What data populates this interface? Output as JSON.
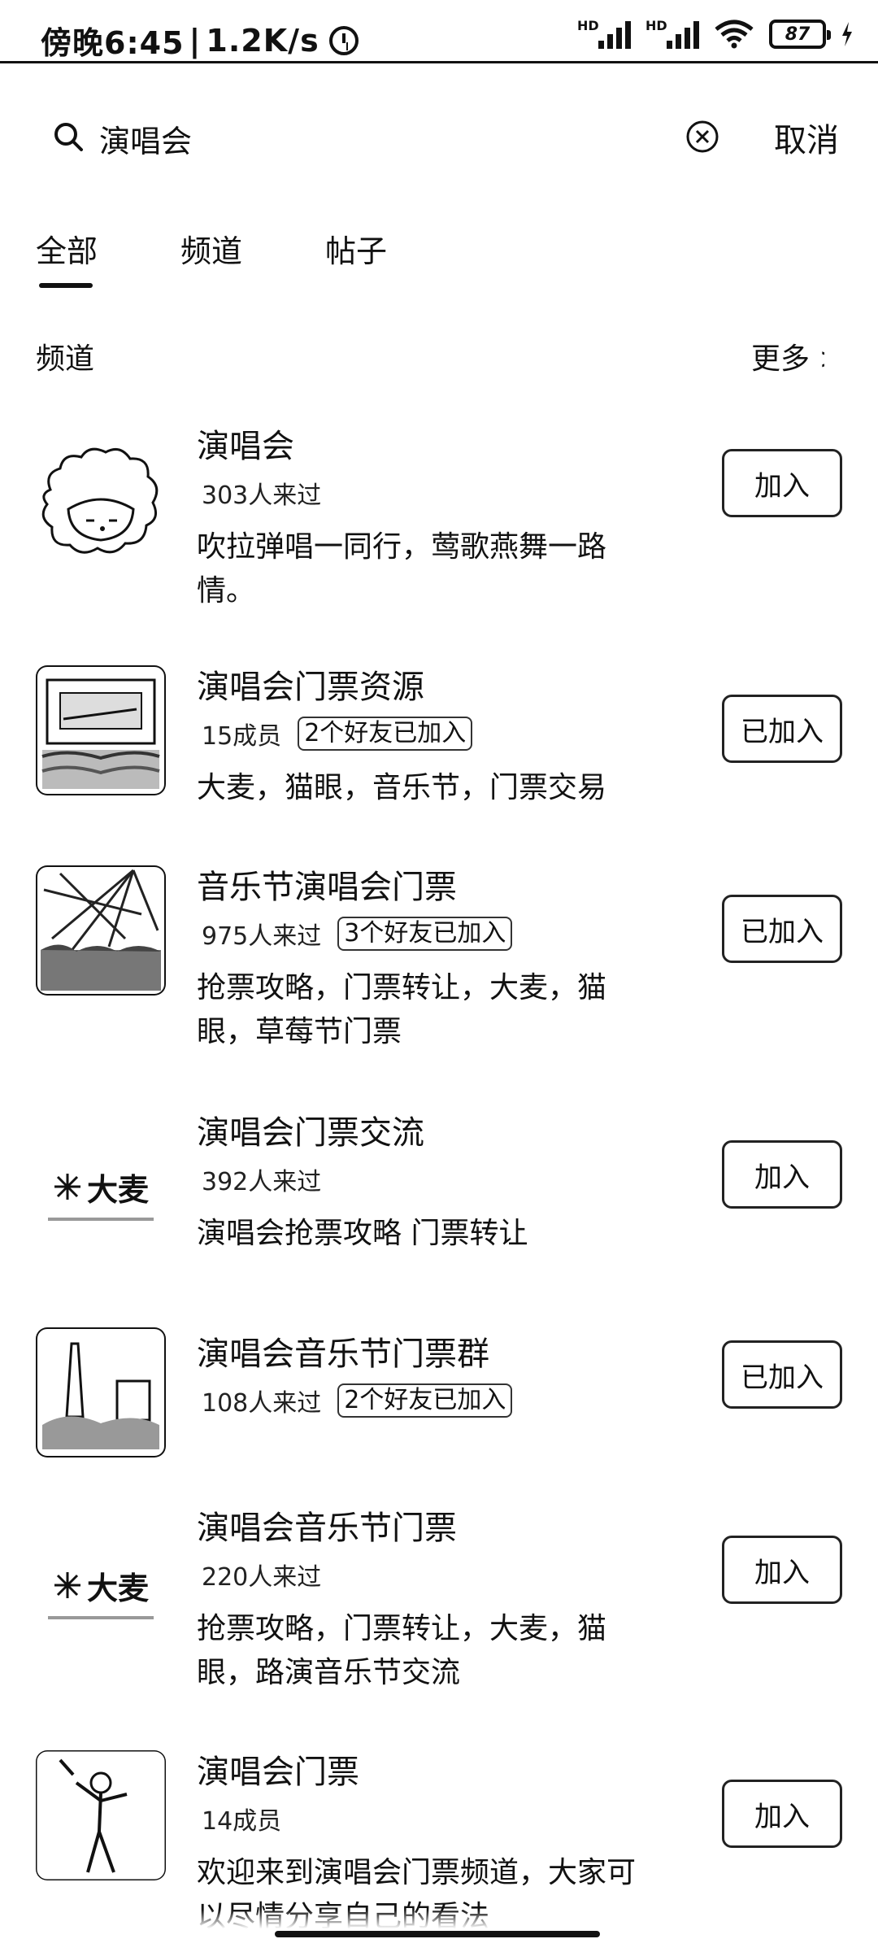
{
  "status_bar": {
    "time": "傍晚6:45",
    "net_speed": "1.2K/s",
    "battery": "87"
  },
  "search": {
    "query": "演唱会",
    "cancel_label": "取消"
  },
  "tabs": [
    {
      "label": "全部"
    },
    {
      "label": "频道"
    },
    {
      "label": "帖子"
    }
  ],
  "section": {
    "title": "频道",
    "more_label": "更多 >"
  },
  "channels": [
    {
      "name": "演唱会",
      "count": "303人来过",
      "friends": "",
      "desc": "吹拉弹唱一同行，莺歌燕舞一路情。",
      "button": "加入",
      "avatar": "cartoon-sheep-avatar"
    },
    {
      "name": "演唱会门票资源",
      "count": "15成员",
      "friends": "2个好友已加入",
      "desc": "大麦，猫眼，音乐节，门票交易",
      "button": "已加入",
      "avatar": "concert-stage-photo"
    },
    {
      "name": "音乐节演唱会门票",
      "count": "975人来过",
      "friends": "3个好友已加入",
      "desc": "抢票攻略，门票转让，大麦，猫眼，草莓节门票",
      "button": "已加入",
      "avatar": "concert-lights-photo"
    },
    {
      "name": "演唱会门票交流",
      "count": "392人来过",
      "friends": "",
      "desc": "演唱会抢票攻略 门票转让",
      "button": "加入",
      "avatar": "damai-logo",
      "logo_text": "大麦"
    },
    {
      "name": "演唱会音乐节门票群",
      "count": "108人来过",
      "friends": "2个好友已加入",
      "desc": "",
      "button": "已加入",
      "avatar": "tower-drawing"
    },
    {
      "name": "演唱会音乐节门票",
      "count": "220人来过",
      "friends": "",
      "desc": "抢票攻略，门票转让，大麦，猫眼，路演音乐节交流",
      "button": "加入",
      "avatar": "damai-logo",
      "logo_text": "大麦"
    },
    {
      "name": "演唱会门票",
      "count": "14成员",
      "friends": "",
      "desc": "欢迎来到演唱会门票频道，大家可以尽情分享自己的看法",
      "button": "加入",
      "avatar": "singer-figure"
    }
  ]
}
